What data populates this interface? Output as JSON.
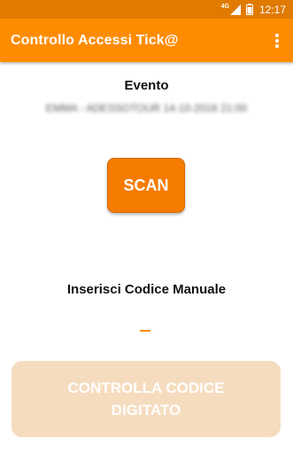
{
  "status_bar": {
    "network_label": "4G",
    "time": "12:17",
    "icons": [
      "signal-icon",
      "battery-icon"
    ]
  },
  "app_bar": {
    "title": "Controllo Accessi Tick@",
    "menu_icon": "more-vert-icon"
  },
  "event": {
    "label": "Evento",
    "name": "EMMA - ADESSOTOUR 14-10-2016 21:00"
  },
  "scan_button": {
    "label": "SCAN"
  },
  "manual_entry": {
    "label": "Inserisci Codice Manuale",
    "value": ""
  },
  "check_button": {
    "label": "CONTROLLA CODICE DIGITATO",
    "enabled": false
  },
  "colors": {
    "status_bar": "#e07a00",
    "app_bar": "#ff8c00",
    "accent": "#f57c00",
    "disabled_button": "#f6dcbf"
  }
}
